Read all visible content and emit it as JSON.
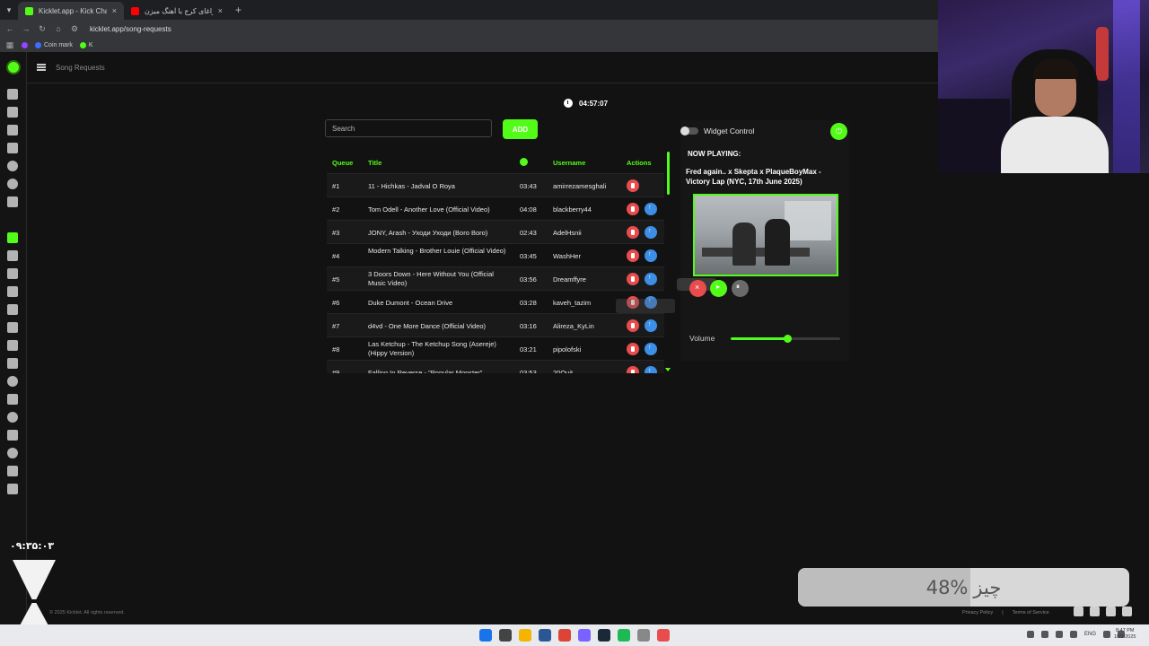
{
  "browser": {
    "tabs": [
      {
        "label": "Kicklet.app - Kick Chatbot"
      },
      {
        "label": "وقتی چراغای کرج با آهنگ میزن"
      }
    ],
    "url": "kicklet.app/song-requests",
    "bookmarks": [
      "Coin mark",
      "K"
    ]
  },
  "app": {
    "page_title": "Song Requests",
    "clock": "04:57:07",
    "search": {
      "placeholder": "Search",
      "value": ""
    },
    "add_label": "ADD",
    "table": {
      "headers": {
        "queue": "Queue",
        "title": "Title",
        "username": "Username",
        "actions": "Actions"
      },
      "rows": [
        {
          "q": "#1",
          "title": "11 - Hichkas - Jadval O Roya",
          "dur": "03:43",
          "user": "amirrezamesghali"
        },
        {
          "q": "#2",
          "title": "Tom Odell - Another Love (Official Video)",
          "dur": "04:08",
          "user": "blackberry44"
        },
        {
          "q": "#3",
          "title": "JONY, Arash - Уходи Уходи (Boro Boro)",
          "dur": "02:43",
          "user": "AdelHsnii"
        },
        {
          "q": "#4",
          "title": "Modern Talking - Brother Louie (Official Video)",
          "dur": "03:45",
          "user": "WashHer"
        },
        {
          "q": "#5",
          "title": "3 Doors Down - Here Without You (Official Music Video)",
          "dur": "03:56",
          "user": "Dreamffyre"
        },
        {
          "q": "#6",
          "title": "Duke Dumont - Ocean Drive",
          "dur": "03:28",
          "user": "kaveh_tazim"
        },
        {
          "q": "#7",
          "title": "d4vd - One More Dance (Official Video)",
          "dur": "03:16",
          "user": "Alireza_KyLin"
        },
        {
          "q": "#8",
          "title": "Las Ketchup - The Ketchup Song (Asereje) (Hippy Version)",
          "dur": "03:21",
          "user": "pipolofski"
        },
        {
          "q": "#9",
          "title": "Falling In Reverse - \"Popular Monster\"",
          "dur": "03:53",
          "user": "20Quit"
        }
      ]
    },
    "widget": {
      "control_label": "Widget Control",
      "now_playing_label": "NOW PLAYING:",
      "now_playing_title": "Fred again.. x Skepta x PlaqueBoyMax - Victory Lap (NYC, 17th June 2025)",
      "volume_label": "Volume",
      "volume_level": 0.52
    },
    "footer": {
      "copyright": "© 2025 Kicklet. All rights reserved.",
      "privacy": "Privacy Policy",
      "separator": "|",
      "terms": "Terms of Service"
    }
  },
  "overlay": {
    "timer": "۰۹:۳۵:۰۳",
    "progress_percent_text": "48%",
    "progress_word": "چیز",
    "progress_level": 0.48
  },
  "taskbar": {
    "lang": "ENG",
    "time": "8:47 PM",
    "date": "10/1/2025"
  },
  "colors": {
    "accent": "#53fc18",
    "danger": "#e84c4c",
    "info": "#3d8ee6"
  }
}
